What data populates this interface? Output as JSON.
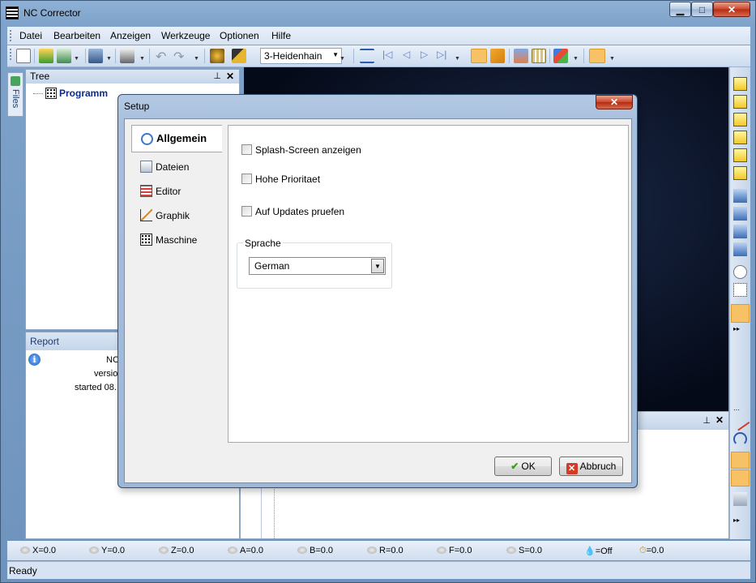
{
  "window": {
    "title": "NC Corrector"
  },
  "menu": [
    "Datei",
    "Bearbeiten",
    "Anzeigen",
    "Werkzeuge",
    "Optionen",
    "Hilfe"
  ],
  "toolbar": {
    "controller_select": "3-Heidenhain"
  },
  "tree": {
    "title": "Tree",
    "root": "Programm"
  },
  "files_tab": "Files",
  "report": {
    "title": "Report",
    "lines": [
      "NC",
      "versio",
      "started 08."
    ]
  },
  "coords": [
    "X=0.0",
    "Y=0.0",
    "Z=0.0",
    "A=0.0",
    "B=0.0",
    "R=0.0",
    "F=0.0",
    "S=0.0",
    "=Off",
    "=0.0"
  ],
  "status": "Ready",
  "dialog": {
    "title": "Setup",
    "tabs": [
      "Allgemein",
      "Dateien",
      "Editor",
      "Graphik",
      "Maschine"
    ],
    "options": [
      "Splash-Screen anzeigen",
      "Hohe Prioritaet",
      "Auf Updates pruefen"
    ],
    "language_group": "Sprache",
    "language_value": "German",
    "ok": "OK",
    "cancel": "Abbruch"
  },
  "colors": {
    "accent": "#f7a838",
    "title_bg": "#7ea2c9",
    "gfx_bg": "#0a1224"
  }
}
